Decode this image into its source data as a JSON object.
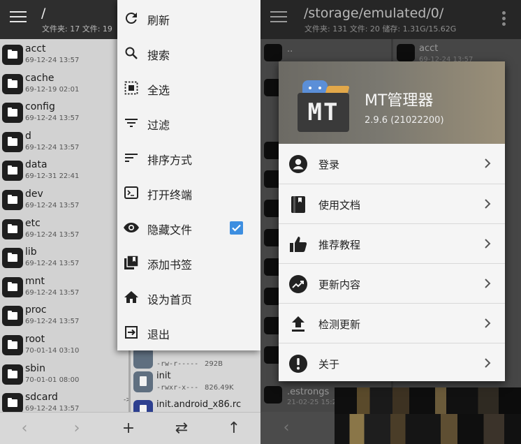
{
  "left_pane": {
    "path": "/",
    "stats": "文件夹: 17  文件: 19",
    "folders": [
      {
        "name": "acct",
        "date": "69-12-24 13:57"
      },
      {
        "name": "cache",
        "date": "69-12-19 02:01"
      },
      {
        "name": "config",
        "date": "69-12-24 13:57"
      },
      {
        "name": "d",
        "date": "69-12-24 13:57"
      },
      {
        "name": "data",
        "date": "69-12-31 22:41"
      },
      {
        "name": "dev",
        "date": "69-12-24 13:57"
      },
      {
        "name": "etc",
        "date": "69-12-24 13:57"
      },
      {
        "name": "lib",
        "date": "69-12-24 13:57"
      },
      {
        "name": "mnt",
        "date": "69-12-24 13:57"
      },
      {
        "name": "proc",
        "date": "69-12-24 13:57"
      },
      {
        "name": "root",
        "date": "70-01-14 03:10"
      },
      {
        "name": "sbin",
        "date": "70-01-01 08:00"
      },
      {
        "name": "sdcard",
        "date": "69-12-24 13:57"
      }
    ],
    "files": [
      {
        "name": "",
        "perm": "-rw-r-----",
        "size": "292B"
      },
      {
        "name": "init",
        "perm": "-rwxr-x---",
        "size": "826.49K"
      },
      {
        "name": "init.android_x86.rc",
        "perm": "",
        "size": ""
      }
    ],
    "symlink_mark": "->"
  },
  "popup_menu": {
    "items": [
      {
        "label": "刷新",
        "icon": "refresh-icon"
      },
      {
        "label": "搜索",
        "icon": "search-icon"
      },
      {
        "label": "全选",
        "icon": "select-all-icon"
      },
      {
        "label": "过滤",
        "icon": "filter-icon"
      },
      {
        "label": "排序方式",
        "icon": "sort-icon"
      },
      {
        "label": "打开终端",
        "icon": "terminal-icon"
      },
      {
        "label": "隐藏文件",
        "icon": "eye-icon",
        "checked": true
      },
      {
        "label": "添加书签",
        "icon": "bookmark-icon"
      },
      {
        "label": "设为首页",
        "icon": "home-icon"
      },
      {
        "label": "退出",
        "icon": "exit-icon"
      }
    ]
  },
  "right_pane": {
    "path": "/storage/emulated/0/",
    "stats": "文件夹: 131  文件: 20  储存: 1.31G/15.62G",
    "visible_items": [
      {
        "name": "..",
        "date": ""
      },
      {
        "name": "acct",
        "date": "69-12-24 13:57"
      },
      {
        "name": ".estrongs",
        "date": "21-02-25 15:26"
      }
    ]
  },
  "about_dialog": {
    "logo_text": "MT",
    "app_name": "MT管理器",
    "version": "2.9.6 (21022200)",
    "items": [
      {
        "label": "登录",
        "icon": "account-icon"
      },
      {
        "label": "使用文档",
        "icon": "book-icon"
      },
      {
        "label": "推荐教程",
        "icon": "thumb-up-icon"
      },
      {
        "label": "更新内容",
        "icon": "trending-icon"
      },
      {
        "label": "检测更新",
        "icon": "upload-icon"
      },
      {
        "label": "关于",
        "icon": "info-icon"
      }
    ]
  },
  "colors": {
    "accent": "#3d8ee0",
    "appbar": "#2e2e2e",
    "menu_bg": "#f3f3f3"
  }
}
